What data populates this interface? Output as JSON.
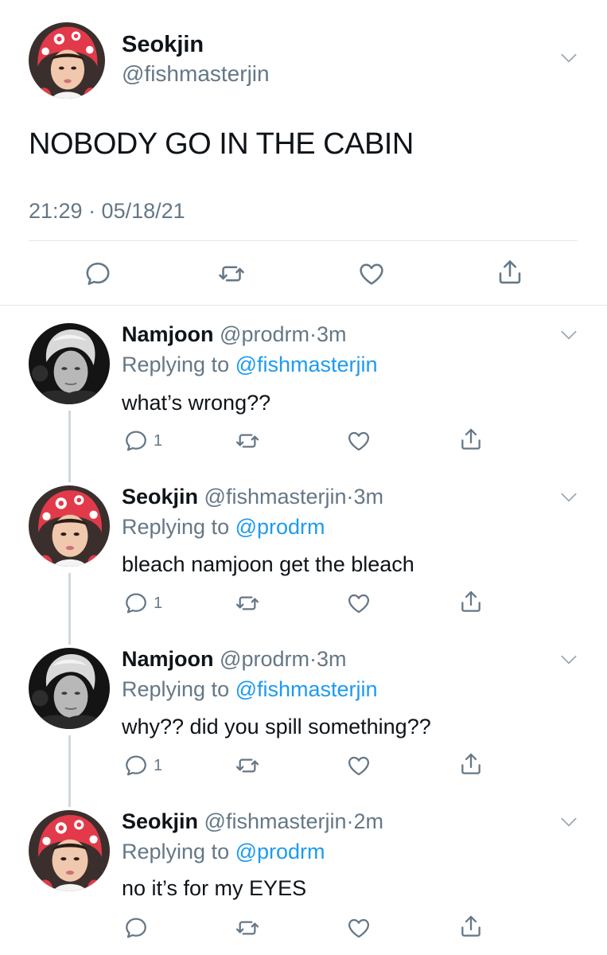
{
  "main_tweet": {
    "display_name": "Seokjin",
    "handle": "@fishmasterjin",
    "text": "NOBODY GO IN THE CABIN",
    "timestamp": "21:29 · 05/18/21",
    "avatar": "seokjin-red-hat-avatar"
  },
  "replies": [
    {
      "display_name": "Namjoon",
      "handle": "@prodrm",
      "time": "3m",
      "replying_label": "Replying to",
      "replying_to": "@fishmasterjin",
      "text": "what’s wrong??",
      "reply_count": "1",
      "avatar": "namjoon-bw-avatar"
    },
    {
      "display_name": "Seokjin",
      "handle": "@fishmasterjin",
      "time": "3m",
      "replying_label": "Replying to",
      "replying_to": "@prodrm",
      "text": "bleach namjoon get the bleach",
      "reply_count": "1",
      "avatar": "seokjin-red-hat-avatar"
    },
    {
      "display_name": "Namjoon",
      "handle": "@prodrm",
      "time": "3m",
      "replying_label": "Replying to",
      "replying_to": "@fishmasterjin",
      "text": "why?? did you spill something??",
      "reply_count": "1",
      "avatar": "namjoon-bw-avatar"
    },
    {
      "display_name": "Seokjin",
      "handle": "@fishmasterjin",
      "time": "2m",
      "replying_label": "Replying to",
      "replying_to": "@prodrm",
      "text": "no it’s for my EYES",
      "reply_count": "",
      "avatar": "seokjin-red-hat-avatar"
    }
  ],
  "separator": "·",
  "colors": {
    "link": "#1d9bf0",
    "muted": "#657786",
    "divider": "#e1e8ed",
    "thread_line": "#cfd9de"
  },
  "icons": {
    "reply": "reply-icon",
    "retweet": "retweet-icon",
    "like": "heart-icon",
    "share": "share-icon",
    "menu": "chevron-down-icon"
  }
}
